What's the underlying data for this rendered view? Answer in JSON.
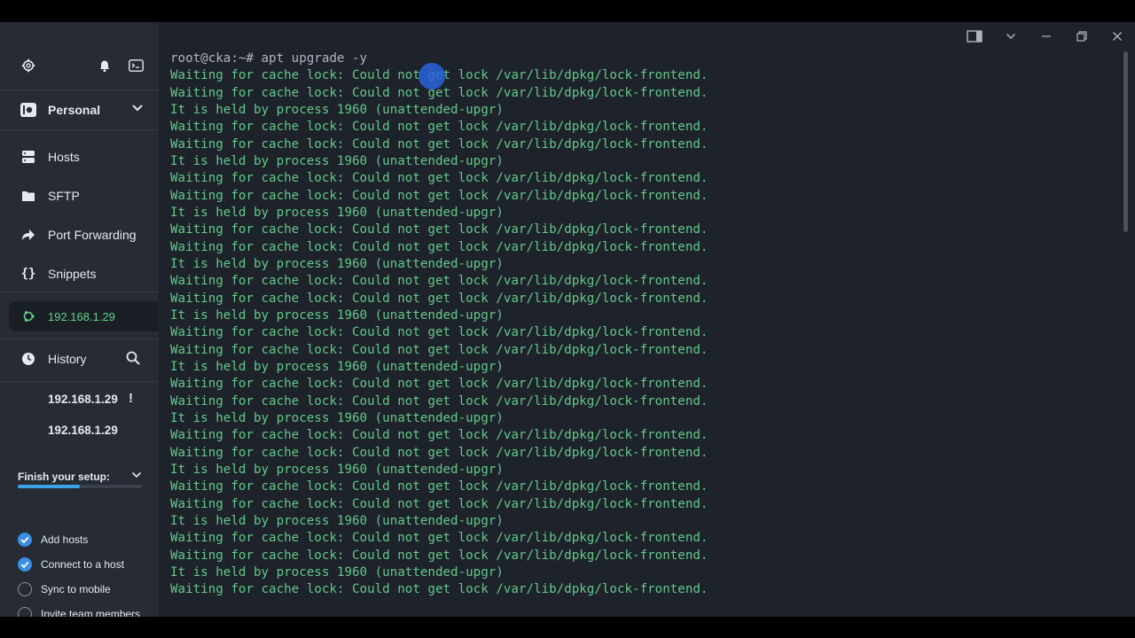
{
  "sidebar": {
    "top_icons": [
      "gear-icon",
      "bell-icon",
      "terminal-icon"
    ],
    "vault_label": "Personal",
    "nav": [
      {
        "label": "Hosts",
        "icon": "hosts-icon"
      },
      {
        "label": "SFTP",
        "icon": "folder-icon"
      },
      {
        "label": "Port Forwarding",
        "icon": "forward-arrow-icon"
      },
      {
        "label": "Snippets",
        "icon": "braces-icon"
      },
      {
        "label": "192.168.1.29",
        "icon": "ubuntu-icon"
      }
    ],
    "history_label": "History",
    "history_items": [
      {
        "label": "192.168.1.29",
        "badge": "!"
      },
      {
        "label": "192.168.1.29",
        "badge": ""
      }
    ],
    "setup": {
      "title": "Finish your setup:",
      "progress": 0.5,
      "items": [
        {
          "label": "Add hosts",
          "done": true
        },
        {
          "label": "Connect to a host",
          "done": true
        },
        {
          "label": "Sync to mobile",
          "done": false
        },
        {
          "label": "Invite team members",
          "done": false
        }
      ]
    }
  },
  "terminal": {
    "prompt": "root@cka:~# ",
    "command": "apt upgrade -y",
    "lines": [
      "Waiting for cache lock: Could not get lock /var/lib/dpkg/lock-frontend.",
      "Waiting for cache lock: Could not get lock /var/lib/dpkg/lock-frontend.",
      "It is held by process 1960 (unattended-upgr)",
      "Waiting for cache lock: Could not get lock /var/lib/dpkg/lock-frontend.",
      "Waiting for cache lock: Could not get lock /var/lib/dpkg/lock-frontend.",
      "It is held by process 1960 (unattended-upgr)",
      "Waiting for cache lock: Could not get lock /var/lib/dpkg/lock-frontend.",
      "Waiting for cache lock: Could not get lock /var/lib/dpkg/lock-frontend.",
      "It is held by process 1960 (unattended-upgr)",
      "Waiting for cache lock: Could not get lock /var/lib/dpkg/lock-frontend.",
      "Waiting for cache lock: Could not get lock /var/lib/dpkg/lock-frontend.",
      "It is held by process 1960 (unattended-upgr)",
      "Waiting for cache lock: Could not get lock /var/lib/dpkg/lock-frontend.",
      "Waiting for cache lock: Could not get lock /var/lib/dpkg/lock-frontend.",
      "It is held by process 1960 (unattended-upgr)",
      "Waiting for cache lock: Could not get lock /var/lib/dpkg/lock-frontend.",
      "Waiting for cache lock: Could not get lock /var/lib/dpkg/lock-frontend.",
      "It is held by process 1960 (unattended-upgr)",
      "Waiting for cache lock: Could not get lock /var/lib/dpkg/lock-frontend.",
      "Waiting for cache lock: Could not get lock /var/lib/dpkg/lock-frontend.",
      "It is held by process 1960 (unattended-upgr)",
      "Waiting for cache lock: Could not get lock /var/lib/dpkg/lock-frontend.",
      "Waiting for cache lock: Could not get lock /var/lib/dpkg/lock-frontend.",
      "It is held by process 1960 (unattended-upgr)",
      "Waiting for cache lock: Could not get lock /var/lib/dpkg/lock-frontend.",
      "Waiting for cache lock: Could not get lock /var/lib/dpkg/lock-frontend.",
      "It is held by process 1960 (unattended-upgr)",
      "Waiting for cache lock: Could not get lock /var/lib/dpkg/lock-frontend.",
      "Waiting for cache lock: Could not get lock /var/lib/dpkg/lock-frontend.",
      "It is held by process 1960 (unattended-upgr)",
      "Waiting for cache lock: Could not get lock /var/lib/dpkg/lock-frontend."
    ],
    "window_controls": [
      "split-view-icon",
      "chevron-down-icon",
      "minimize-icon",
      "restore-icon",
      "close-icon"
    ]
  },
  "colors": {
    "terminal_bg": "#1e222a",
    "sidebar_bg": "#262b34",
    "output_green": "#62c98a",
    "active_green": "#5fd48a",
    "accent_blue": "#3a8ee6"
  }
}
